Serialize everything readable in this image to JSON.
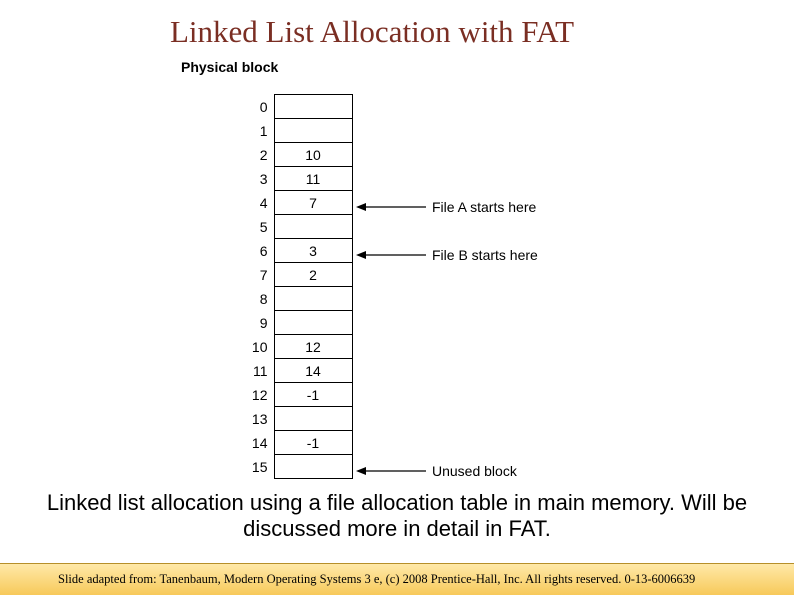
{
  "title": "Linked List Allocation with FAT",
  "diagram": {
    "header": "Physical\nblock",
    "rows": [
      {
        "index": "0",
        "value": ""
      },
      {
        "index": "1",
        "value": ""
      },
      {
        "index": "2",
        "value": "10"
      },
      {
        "index": "3",
        "value": "11"
      },
      {
        "index": "4",
        "value": "7"
      },
      {
        "index": "5",
        "value": ""
      },
      {
        "index": "6",
        "value": "3"
      },
      {
        "index": "7",
        "value": "2"
      },
      {
        "index": "8",
        "value": ""
      },
      {
        "index": "9",
        "value": ""
      },
      {
        "index": "10",
        "value": "12"
      },
      {
        "index": "11",
        "value": "14"
      },
      {
        "index": "12",
        "value": "-1"
      },
      {
        "index": "13",
        "value": ""
      },
      {
        "index": "14",
        "value": "-1"
      },
      {
        "index": "15",
        "value": ""
      }
    ],
    "annotations": {
      "fileA": "File A starts here",
      "fileB": "File B starts here",
      "unused": "Unused block"
    }
  },
  "caption": "Linked list allocation using a file allocation table in main memory. Will be discussed more in detail in FAT.",
  "attribution": "Slide adapted from: Tanenbaum, Modern Operating Systems 3 e, (c) 2008 Prentice-Hall, Inc. All rights reserved. 0-13-6006639"
}
